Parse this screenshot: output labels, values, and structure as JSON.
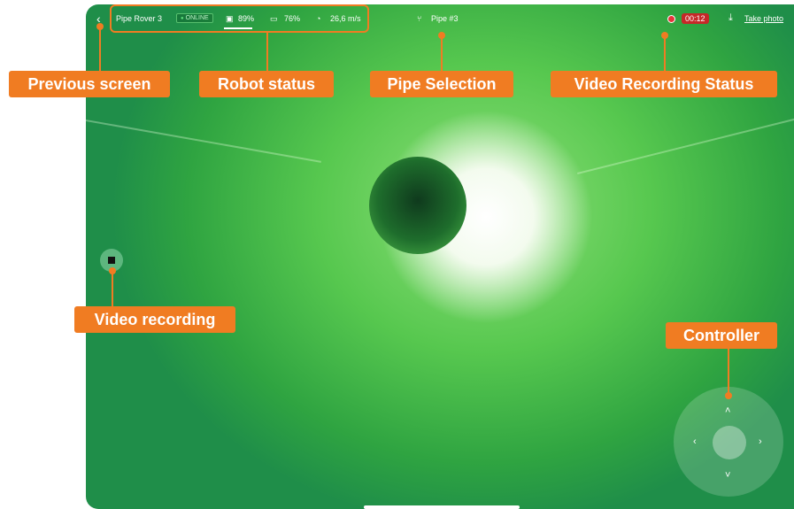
{
  "topbar": {
    "back_icon": "chevron-left-icon",
    "robot_name": "Pipe Rover 3",
    "status": "ONLINE",
    "signal_value": "89%",
    "battery_value": "76%",
    "speed_value": "26,6 m/s",
    "pipe_label": "Pipe #3",
    "rec_timer": "00:12",
    "take_photo": "Take photo"
  },
  "annotations": {
    "previous_screen": "Previous screen",
    "robot_status": "Robot status",
    "pipe_selection": "Pipe Selection",
    "video_recording_status": "Video Recording Status",
    "video_recording": "Video recording",
    "controller": "Controller"
  },
  "colors": {
    "accent": "#f07c22",
    "recording": "#e6343b",
    "online": "#5ee07c"
  }
}
